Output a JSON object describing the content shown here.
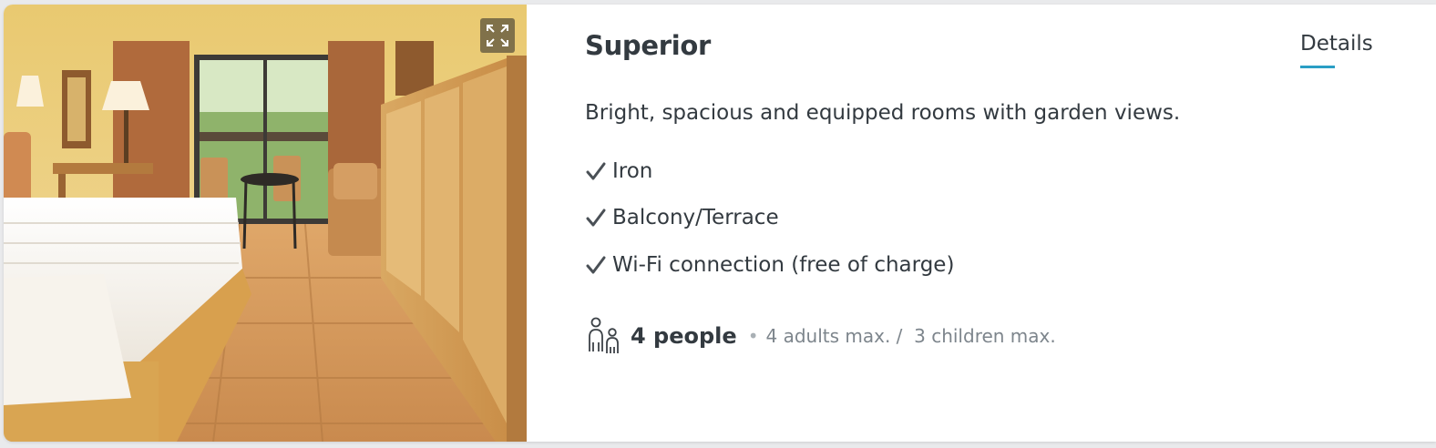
{
  "room": {
    "title": "Superior",
    "details_label": "Details",
    "description": "Bright, spacious and equipped rooms with garden views.",
    "features": [
      "Iron",
      "Balcony/Terrace",
      "Wi-Fi connection (free of charge)"
    ],
    "capacity": {
      "people": "4 people",
      "bullet": "•",
      "adults": "4 adults max. /",
      "children": "3 children max."
    }
  },
  "colors": {
    "accent": "#2a9ec5",
    "text": "#333a40",
    "muted": "#7d858c"
  },
  "icons": {
    "expand": "expand-icon",
    "check": "check-icon",
    "people": "people-icon"
  }
}
